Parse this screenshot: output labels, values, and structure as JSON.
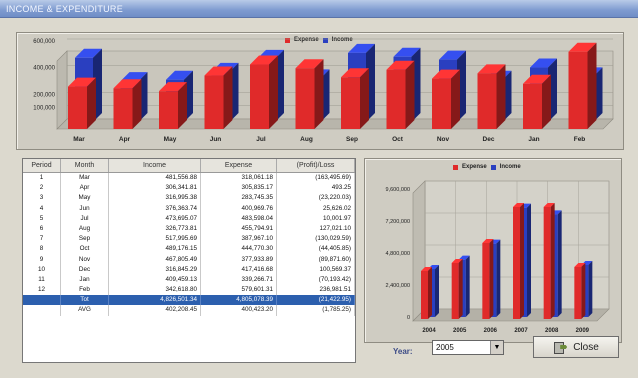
{
  "window": {
    "title": "INCOME & EXPENDITURE"
  },
  "colors": {
    "expense": "#e02a2a",
    "income": "#2a3fc0"
  },
  "monthly_chart": {
    "legend": [
      "Expense",
      "Income"
    ],
    "yticks": [
      "600,000",
      "400,000",
      "200,000",
      "100,000"
    ],
    "chart_data": {
      "type": "bar",
      "categories": [
        "Mar",
        "Apr",
        "May",
        "Jun",
        "Jul",
        "Aug",
        "Sep",
        "Oct",
        "Nov",
        "Dec",
        "Jan",
        "Feb"
      ],
      "series": [
        {
          "name": "Expense",
          "values": [
            318061.18,
            305835.17,
            283745.35,
            400969.76,
            483598.04,
            455794.91,
            387967.1,
            444770.3,
            377933.89,
            417416.68,
            339266.71,
            579601.31
          ]
        },
        {
          "name": "Income",
          "values": [
            481556.88,
            306341.81,
            316995.38,
            376363.74,
            473695.07,
            326773.81,
            517995.69,
            489176.15,
            467805.49,
            316845.29,
            408459.13,
            342618.8
          ]
        }
      ]
    }
  },
  "table": {
    "headers": [
      "Period",
      "Month",
      "Income",
      "Expense",
      "(Profit)/Loss"
    ],
    "rows": [
      [
        "1",
        "Mar",
        "481,556.88",
        "318,061.18",
        "(163,495.69)"
      ],
      [
        "2",
        "Apr",
        "306,341.81",
        "305,835.17",
        "493.25"
      ],
      [
        "3",
        "May",
        "316,995.38",
        "283,745.35",
        "(23,220.03)"
      ],
      [
        "4",
        "Jun",
        "376,363.74",
        "400,969.76",
        "25,626.02"
      ],
      [
        "5",
        "Jul",
        "473,695.07",
        "483,598.04",
        "10,001.97"
      ],
      [
        "6",
        "Aug",
        "326,773.81",
        "455,794.91",
        "127,021.10"
      ],
      [
        "7",
        "Sep",
        "517,995.69",
        "387,967.10",
        "(130,029.59)"
      ],
      [
        "8",
        "Oct",
        "489,176.15",
        "444,770.30",
        "(44,405.85)"
      ],
      [
        "9",
        "Nov",
        "467,805.49",
        "377,933.89",
        "(89,871.60)"
      ],
      [
        "10",
        "Dec",
        "316,845.29",
        "417,416.68",
        "100,569.37"
      ],
      [
        "11",
        "Jan",
        "409,459.13",
        "339,266.71",
        "(70,193.42)"
      ],
      [
        "12",
        "Feb",
        "342,618.80",
        "579,601.31",
        "236,981.51"
      ]
    ],
    "total": [
      "",
      "Tot",
      "4,826,501.34",
      "4,805,078.39",
      "(21,422.95)"
    ],
    "avg": [
      "",
      "AVG",
      "402,208.45",
      "400,423.20",
      "(1,785.25)"
    ]
  },
  "yearly_chart": {
    "legend": [
      "Expense",
      "Income"
    ],
    "yticks": [
      "9,600,000",
      "7,200,000",
      "4,800,000",
      "2,400,000",
      "0"
    ],
    "chart_data": {
      "type": "bar",
      "categories": [
        "2004",
        "2005",
        "2006",
        "2007",
        "2008",
        "2009"
      ],
      "ylim": [
        0,
        9600000
      ],
      "series": [
        {
          "name": "Expense",
          "values": [
            3600000,
            4200000,
            5700000,
            8400000,
            8400000,
            3900000
          ]
        },
        {
          "name": "Income",
          "values": [
            3600000,
            4300000,
            5500000,
            8200000,
            7700000,
            3900000
          ]
        }
      ]
    }
  },
  "footer": {
    "year_label": "Year:",
    "year_value": "2005",
    "close_label": "Close"
  }
}
